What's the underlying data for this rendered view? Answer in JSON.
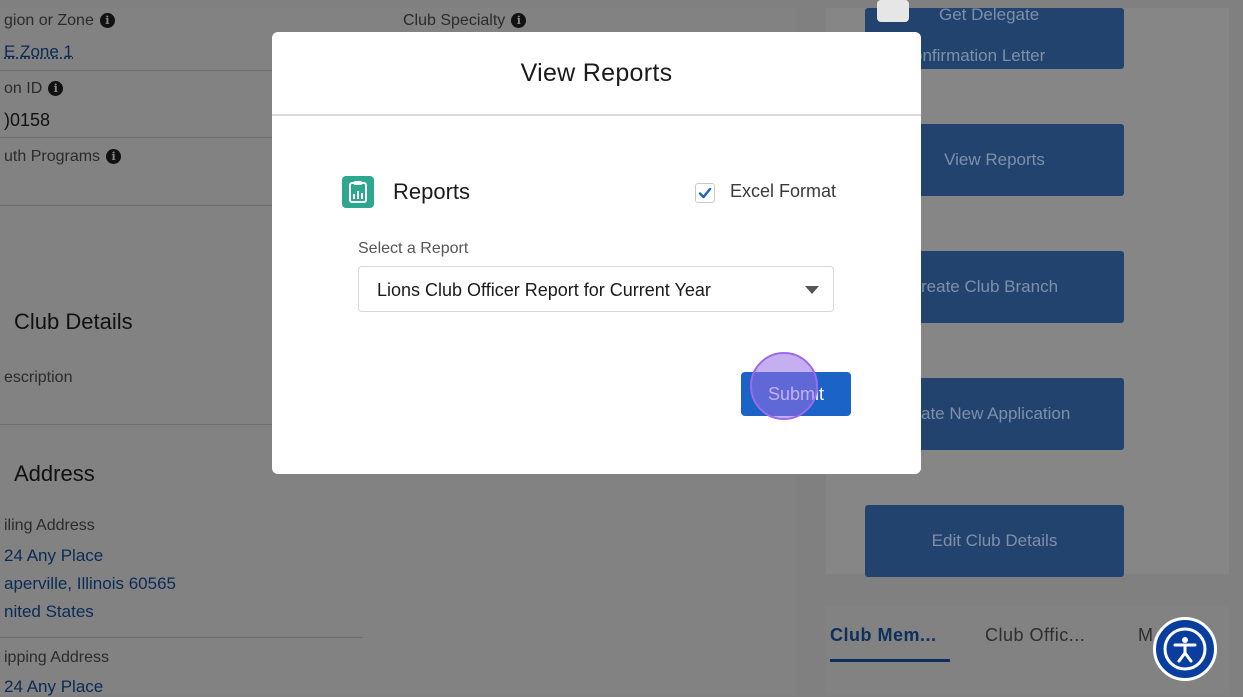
{
  "left_panel": {
    "region_label": "gion or Zone",
    "region_value": "E Zone 1",
    "specialty_label": "Club Specialty",
    "id_label": "on ID",
    "id_value": ")0158",
    "youth_label": "uth Programs",
    "club_details_header": "Club Details",
    "description_label": "escription",
    "address_header": "Address",
    "mailing_label": "iling Address",
    "mailing_line1": "24 Any Place",
    "mailing_line2": "aperville, Illinois 60565",
    "mailing_line3": "nited States",
    "shipping_label": "ipping Address",
    "shipping_line1": "24 Any Place"
  },
  "side_buttons": {
    "delegate_line1": "Get Delegate",
    "delegate_line2": "onfirmation Letter",
    "view_reports": "View Reports",
    "create_branch": "reate Club Branch",
    "new_application": "ate New Application",
    "edit_club": "Edit Club Details"
  },
  "tabs": {
    "members": "Club Mem...",
    "officers": "Club Offic...",
    "more": "M"
  },
  "modal": {
    "title": "View Reports",
    "section_title": "Reports",
    "excel_label": "Excel Format",
    "excel_checked": true,
    "select_label": "Select a Report",
    "select_value": "Lions Club Officer Report for Current Year",
    "submit_label": "Submit"
  },
  "colors": {
    "primary_button": "#1b63c6",
    "report_icon": "#2ea791",
    "accessibility": "#0a3e9e"
  },
  "icons": {
    "info": "info-icon",
    "report": "report-icon",
    "check": "check-icon",
    "dropdown": "chevron-down-icon",
    "accessibility": "accessibility-icon",
    "close": "close-icon"
  }
}
